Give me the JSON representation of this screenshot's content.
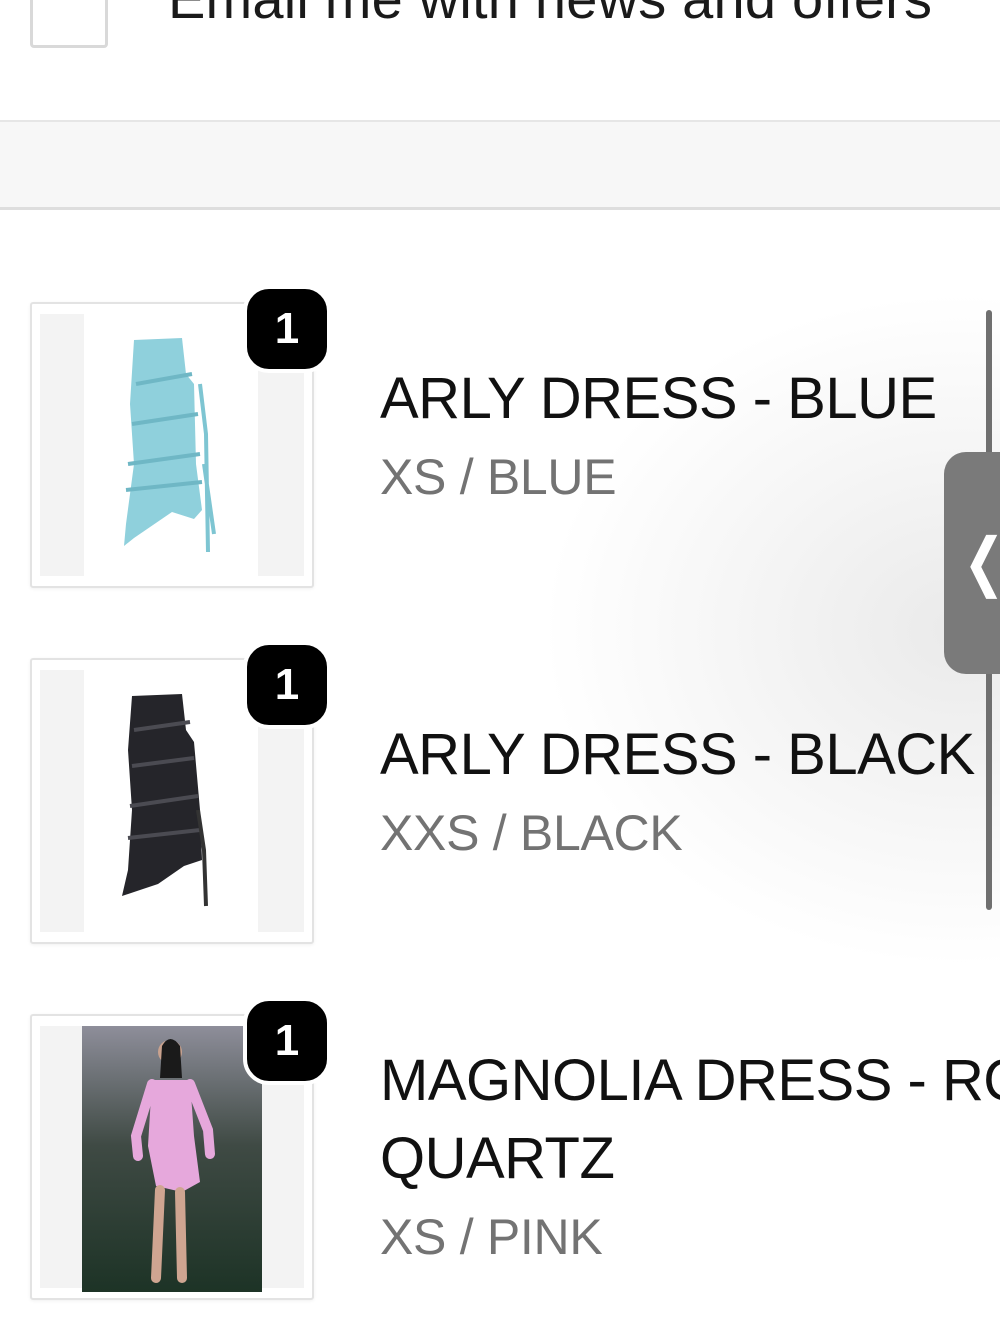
{
  "newsletter": {
    "label": "Email me with news and offers",
    "checked": false
  },
  "order": {
    "items": [
      {
        "title_line1": "ARLY DRESS - BLUE",
        "title_line2": "",
        "variant": "XS / BLUE",
        "quantity": "1",
        "image": "light-blue-dress"
      },
      {
        "title_line1": "ARLY DRESS - BLACK",
        "title_line2": "",
        "variant": "XXS / BLACK",
        "quantity": "1",
        "image": "black-dress"
      },
      {
        "title_line1": "MAGNOLIA DRESS - ROSE",
        "title_line2": "QUARTZ",
        "variant": "XS / PINK",
        "quantity": "1",
        "image": "model-pink-dress"
      }
    ]
  },
  "colors": {
    "badge": "#000000",
    "variant_text": "#737373",
    "handle": "#7a7a7a",
    "blue_dress": "#8fd0dc",
    "black_dress": "#25252a",
    "pink_dress": "#e6a8dc"
  },
  "icons": {
    "collapse_handle": "chevron-left-icon"
  }
}
